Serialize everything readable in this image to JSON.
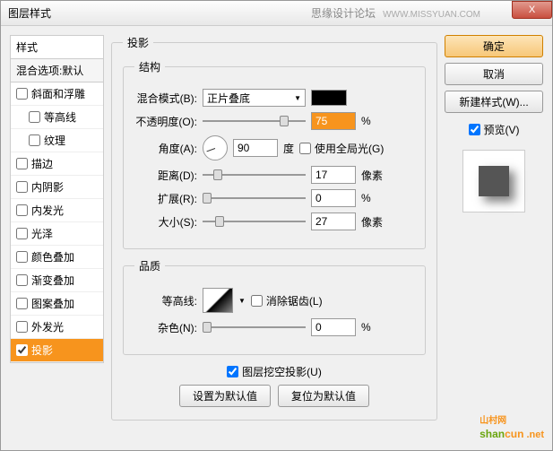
{
  "window": {
    "title": "图层样式",
    "subtitle": "思缘设计论坛",
    "url": "WWW.MISSYUAN.COM",
    "close": "X"
  },
  "styles": {
    "header": "样式",
    "sub": "混合选项:默认",
    "items": [
      {
        "label": "斜面和浮雕",
        "checked": false,
        "indent": false
      },
      {
        "label": "等高线",
        "checked": false,
        "indent": true
      },
      {
        "label": "纹理",
        "checked": false,
        "indent": true
      },
      {
        "label": "描边",
        "checked": false,
        "indent": false
      },
      {
        "label": "内阴影",
        "checked": false,
        "indent": false
      },
      {
        "label": "内发光",
        "checked": false,
        "indent": false
      },
      {
        "label": "光泽",
        "checked": false,
        "indent": false
      },
      {
        "label": "颜色叠加",
        "checked": false,
        "indent": false
      },
      {
        "label": "渐变叠加",
        "checked": false,
        "indent": false
      },
      {
        "label": "图案叠加",
        "checked": false,
        "indent": false
      },
      {
        "label": "外发光",
        "checked": false,
        "indent": false
      },
      {
        "label": "投影",
        "checked": true,
        "indent": false,
        "selected": true
      }
    ]
  },
  "main": {
    "title": "投影",
    "structure": {
      "legend": "结构",
      "blendMode": {
        "label": "混合模式(B):",
        "value": "正片叠底"
      },
      "opacity": {
        "label": "不透明度(O):",
        "value": "75",
        "unit": "%"
      },
      "angle": {
        "label": "角度(A):",
        "value": "90",
        "unit": "度"
      },
      "globalLight": {
        "label": "使用全局光(G)",
        "checked": false
      },
      "distance": {
        "label": "距离(D):",
        "value": "17",
        "unit": "像素"
      },
      "spread": {
        "label": "扩展(R):",
        "value": "0",
        "unit": "%"
      },
      "size": {
        "label": "大小(S):",
        "value": "27",
        "unit": "像素"
      }
    },
    "quality": {
      "legend": "品质",
      "contour": {
        "label": "等高线:"
      },
      "antialias": {
        "label": "消除锯齿(L)",
        "checked": false
      },
      "noise": {
        "label": "杂色(N):",
        "value": "0",
        "unit": "%"
      }
    },
    "knockout": {
      "label": "图层挖空投影(U)",
      "checked": true
    },
    "setDefault": "设置为默认值",
    "resetDefault": "复位为默认值"
  },
  "right": {
    "ok": "确定",
    "cancel": "取消",
    "newStyle": "新建样式(W)...",
    "preview": {
      "label": "预览(V)",
      "checked": true
    }
  },
  "watermark": {
    "text": "shancun",
    "sub": "山村网",
    "net": ".net"
  }
}
